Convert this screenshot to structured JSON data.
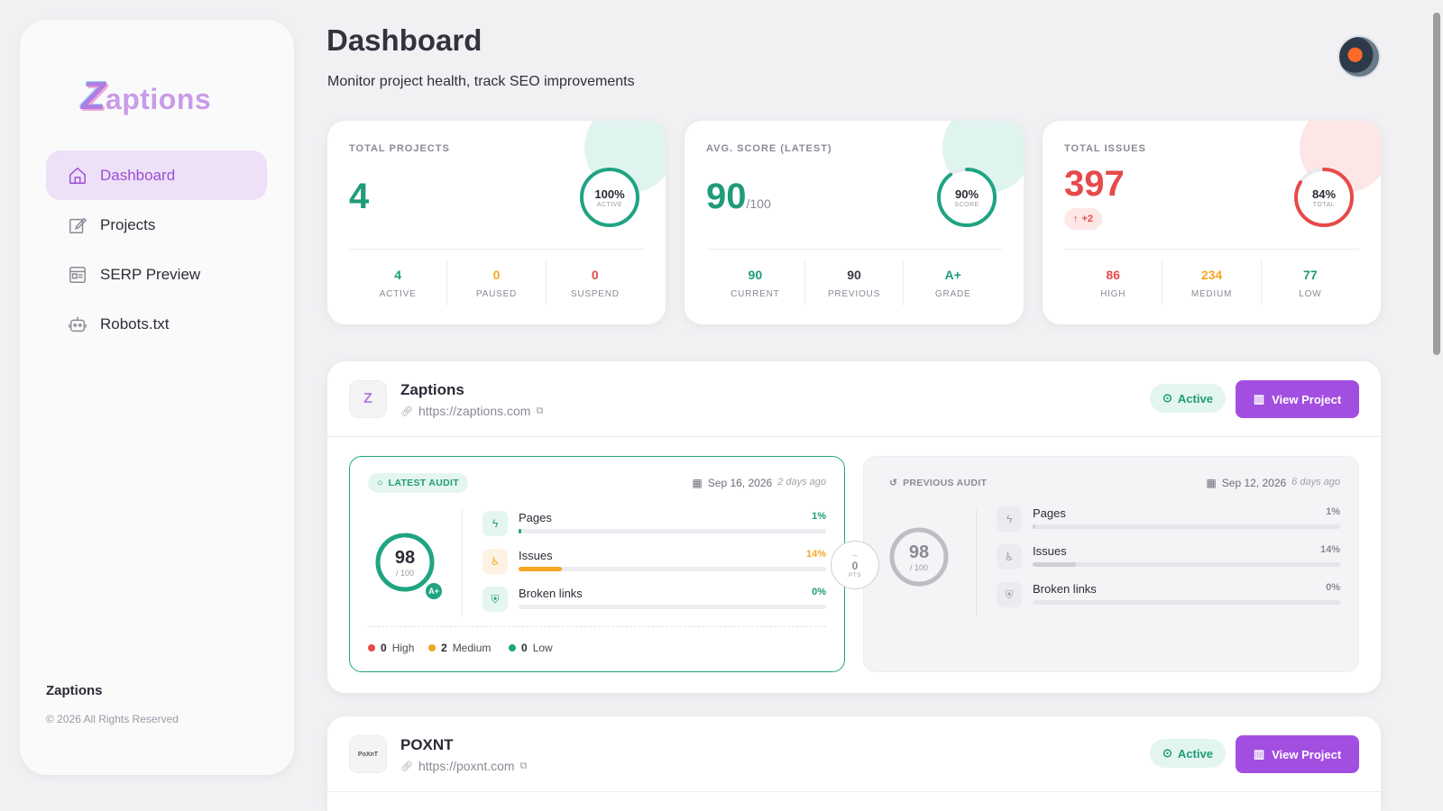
{
  "brand": {
    "logo_initial": "Z",
    "logo_rest": "aptions"
  },
  "sidebar": {
    "items": [
      {
        "label": "Dashboard",
        "icon": "home-icon",
        "active": true
      },
      {
        "label": "Projects",
        "icon": "edit-icon",
        "active": false
      },
      {
        "label": "SERP Preview",
        "icon": "serp-icon",
        "active": false
      },
      {
        "label": "Robots.txt",
        "icon": "robot-icon",
        "active": false
      }
    ],
    "footer_brand": "Zaptions",
    "copyright": "© 2026 All Rights Reserved"
  },
  "header": {
    "title": "Dashboard",
    "subtitle": "Monitor project health, track SEO improvements"
  },
  "stats": {
    "total_projects": {
      "label": "TOTAL PROJECTS",
      "value": "4",
      "ring_pct": "100%",
      "ring_sub": "ACTIVE",
      "ring_fraction": 1.0,
      "cols": [
        {
          "n": "4",
          "l": "ACTIVE"
        },
        {
          "n": "0",
          "l": "PAUSED"
        },
        {
          "n": "0",
          "l": "SUSPEND"
        }
      ]
    },
    "avg_score": {
      "label": "AVG. SCORE (LATEST)",
      "value": "90",
      "value_suffix": "/100",
      "ring_pct": "90%",
      "ring_sub": "SCORE",
      "ring_fraction": 0.9,
      "cols": [
        {
          "n": "90",
          "l": "CURRENT"
        },
        {
          "n": "90",
          "l": "PREVIOUS"
        },
        {
          "n": "A+",
          "l": "GRADE"
        }
      ]
    },
    "total_issues": {
      "label": "TOTAL ISSUES",
      "value": "397",
      "delta": "+2",
      "ring_pct": "84%",
      "ring_sub": "TOTAL",
      "ring_fraction": 0.84,
      "cols": [
        {
          "n": "86",
          "l": "HIGH"
        },
        {
          "n": "234",
          "l": "MEDIUM"
        },
        {
          "n": "77",
          "l": "LOW"
        }
      ]
    }
  },
  "projects": [
    {
      "name": "Zaptions",
      "logo_text": "Z",
      "url": "https://zaptions.com",
      "status": "Active",
      "view_label": "View Project",
      "latest": {
        "tag": "LATEST AUDIT",
        "date": "Sep 16, 2026",
        "ago": "2 days ago",
        "score": "98",
        "score_den": "/ 100",
        "score_fraction": 0.98,
        "grade": "A+",
        "metrics": [
          {
            "name": "Pages",
            "pct": "1%",
            "fraction": 0.01
          },
          {
            "name": "Issues",
            "pct": "14%",
            "fraction": 0.14
          },
          {
            "name": "Broken links",
            "pct": "0%",
            "fraction": 0.0
          }
        ],
        "severity": [
          {
            "count": "0",
            "label": "High"
          },
          {
            "count": "2",
            "label": "Medium"
          },
          {
            "count": "0",
            "label": "Low"
          }
        ]
      },
      "diff": {
        "dash": "–",
        "value": "0",
        "unit": "PTS"
      },
      "previous": {
        "tag": "PREVIOUS AUDIT",
        "date": "Sep 12, 2026",
        "ago": "6 days ago",
        "score": "98",
        "score_den": "/ 100",
        "score_fraction": 0.98,
        "metrics": [
          {
            "name": "Pages",
            "pct": "1%",
            "fraction": 0.01
          },
          {
            "name": "Issues",
            "pct": "14%",
            "fraction": 0.14
          },
          {
            "name": "Broken links",
            "pct": "0%",
            "fraction": 0.0
          }
        ]
      }
    },
    {
      "name": "POXNT",
      "logo_text": "PoXnT",
      "url": "https://poxnt.com",
      "status": "Active",
      "view_label": "View Project"
    }
  ],
  "colors": {
    "accent": "#a24ee0",
    "green": "#1fa482",
    "orange": "#f5a623",
    "red": "#e64a4a"
  }
}
